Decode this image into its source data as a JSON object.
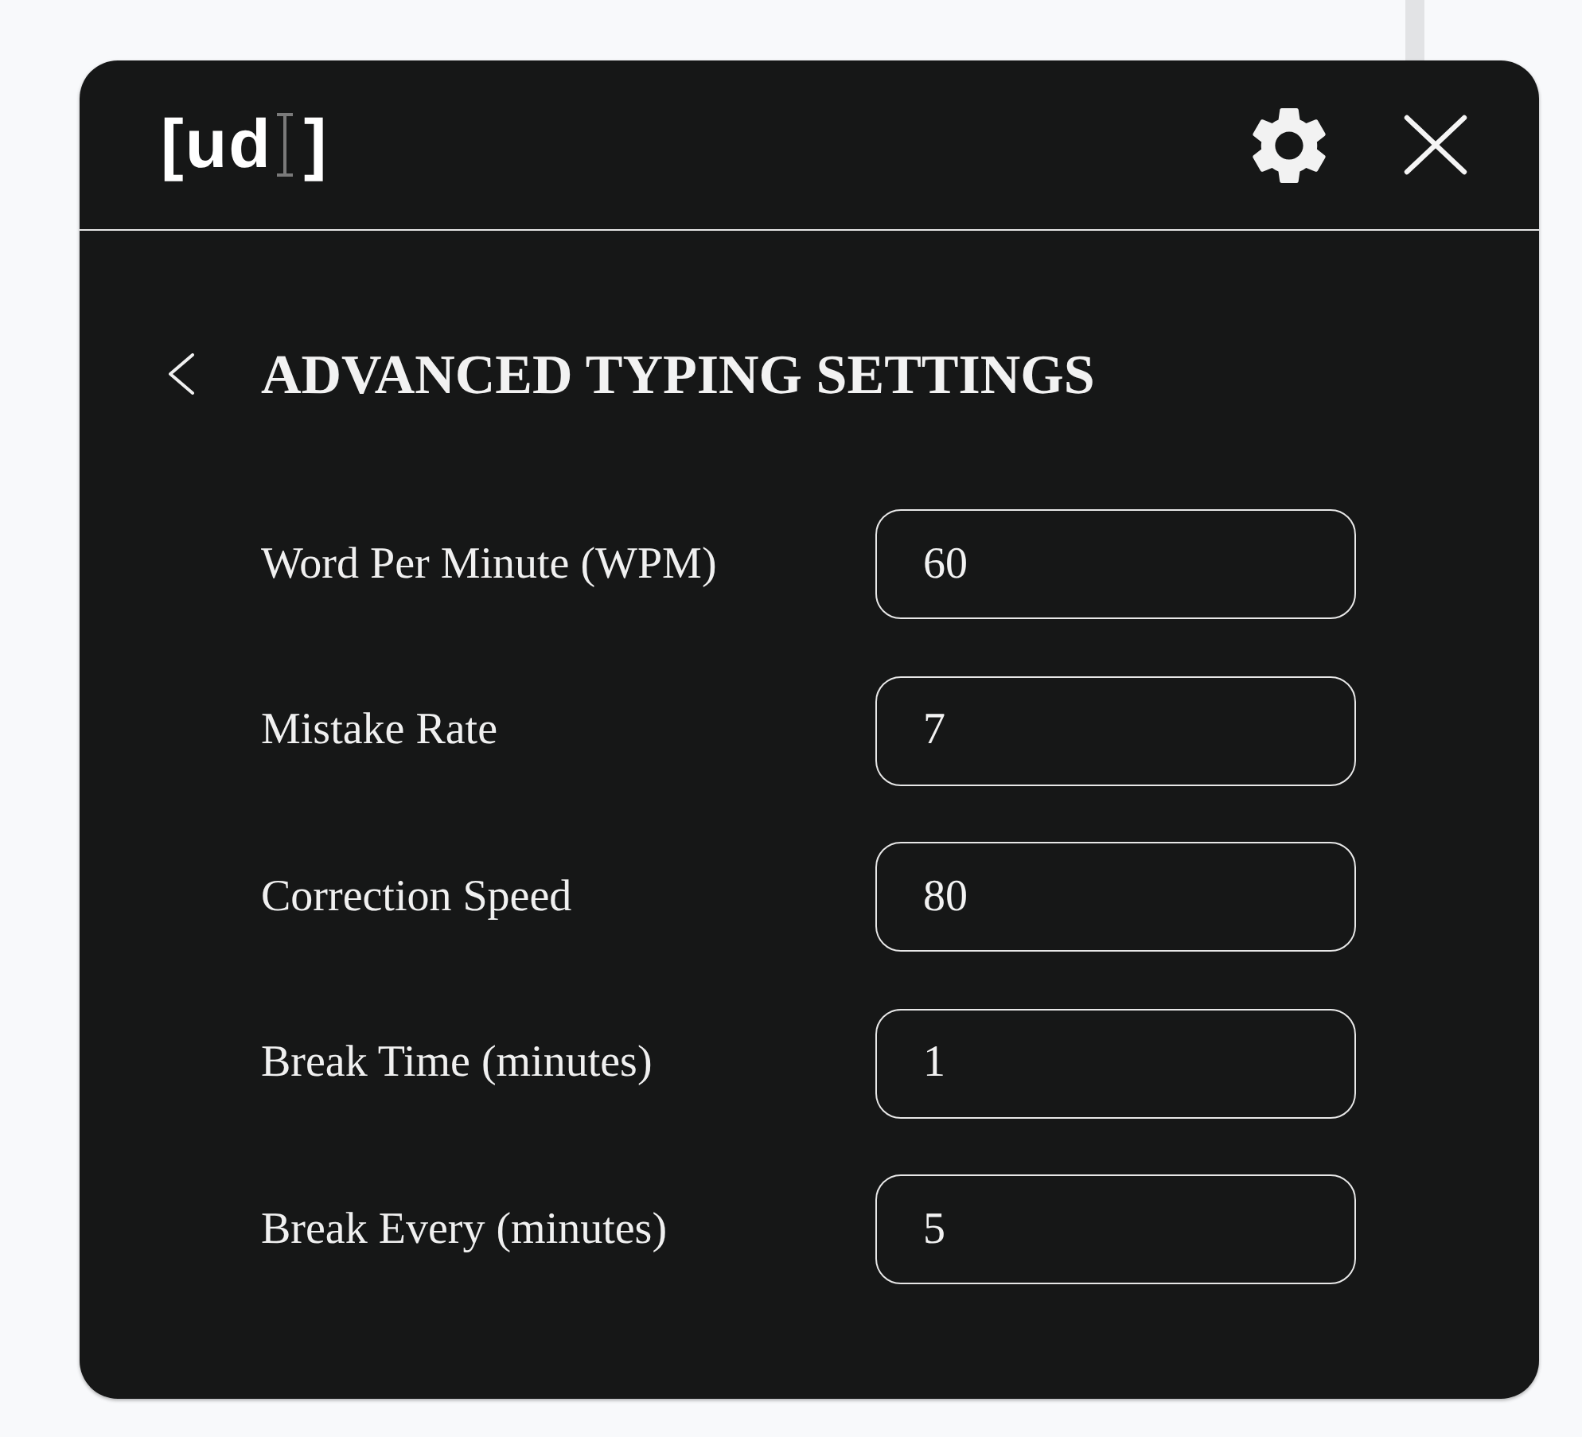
{
  "logo": {
    "before_cursor": "[ud",
    "after_cursor": "]"
  },
  "page": {
    "title": "ADVANCED TYPING SETTINGS"
  },
  "fields": [
    {
      "label": "Word Per Minute (WPM)",
      "value": "60"
    },
    {
      "label": "Mistake Rate",
      "value": "7"
    },
    {
      "label": "Correction Speed",
      "value": "80"
    },
    {
      "label": "Break Time (minutes)",
      "value": "1"
    },
    {
      "label": "Break Every (minutes)",
      "value": "5"
    }
  ]
}
